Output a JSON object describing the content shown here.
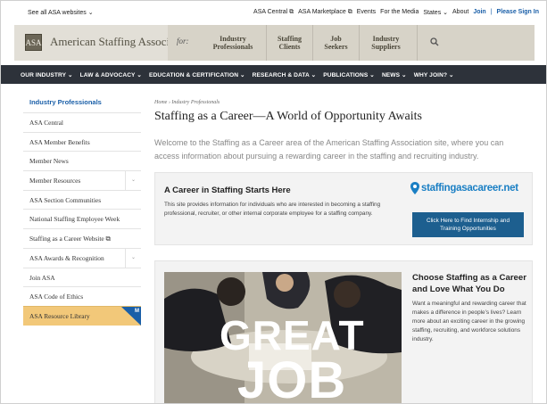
{
  "utility": {
    "see_all": "See all ASA websites ⌄",
    "links": [
      "ASA Central ⧉",
      "ASA Marketplace ⧉",
      "Events",
      "For the Media",
      "States ⌄",
      "About"
    ],
    "join": "Join",
    "divider": "|",
    "sign_in": "Please Sign In"
  },
  "header": {
    "logo_mark": "ASA",
    "logo_text": "American Staffing Association",
    "for_label": "for:",
    "audiences": [
      {
        "line1": "Industry",
        "line2": "Professionals"
      },
      {
        "line1": "Staffing",
        "line2": "Clients"
      },
      {
        "line1": "Job",
        "line2": "Seekers"
      },
      {
        "line1": "Industry",
        "line2": "Suppliers"
      }
    ]
  },
  "main_nav": [
    "OUR INDUSTRY ⌄",
    "LAW & ADVOCACY ⌄",
    "EDUCATION & CERTIFICATION ⌄",
    "RESEARCH & DATA ⌄",
    "PUBLICATIONS ⌄",
    "NEWS ⌄",
    "WHY JOIN? ⌄"
  ],
  "sidebar": {
    "heading": "Industry Professionals",
    "items": [
      {
        "label": "ASA Central"
      },
      {
        "label": "ASA Member Benefits"
      },
      {
        "label": "Member News"
      },
      {
        "label": "Member Resources",
        "chevron": "⌄"
      },
      {
        "label": "ASA Section Communities"
      },
      {
        "label": "National Staffing Employee Week"
      },
      {
        "label": "Staffing as a Career Website ⧉"
      },
      {
        "label": "ASA Awards & Recognition",
        "chevron": "⌄"
      },
      {
        "label": "Join ASA"
      },
      {
        "label": "ASA Code of Ethics"
      },
      {
        "label": "ASA Resource Library",
        "badge": "M"
      }
    ]
  },
  "content": {
    "breadcrumb": "Home › Industry Professionals",
    "title": "Staffing as a Career—A World of Opportunity Awaits",
    "intro": "Welcome to the Staffing as a Career area of the American Staffing Association site, where you can access information about pursuing a rewarding career in the staffing and recruiting industry.",
    "cta": {
      "heading": "A Career in Staffing Starts Here",
      "body": "This site provides information for individuals who are interested in becoming a staffing professional, recruiter, or other internal corporate employee for a staffing company.",
      "site_url": "staffingasacareer.net",
      "button": "Click Here to Find Internship and Training Opportunities"
    },
    "feature": {
      "image_text_1": "GREAT",
      "image_text_2": "JOB",
      "heading": "Choose Staffing as a Career and Love What You Do",
      "body": "Want a meaningful and rewarding career that makes a difference in people’s lives? Learn more about an exciting career in the growing staffing, recruiting, and workforce solutions industry."
    }
  },
  "colors": {
    "link_blue": "#1a5fa8",
    "nav_dark": "#2d323a",
    "header_tan": "#e2dfd7",
    "highlight": "#f2c879",
    "button_blue": "#1d5f8f"
  }
}
